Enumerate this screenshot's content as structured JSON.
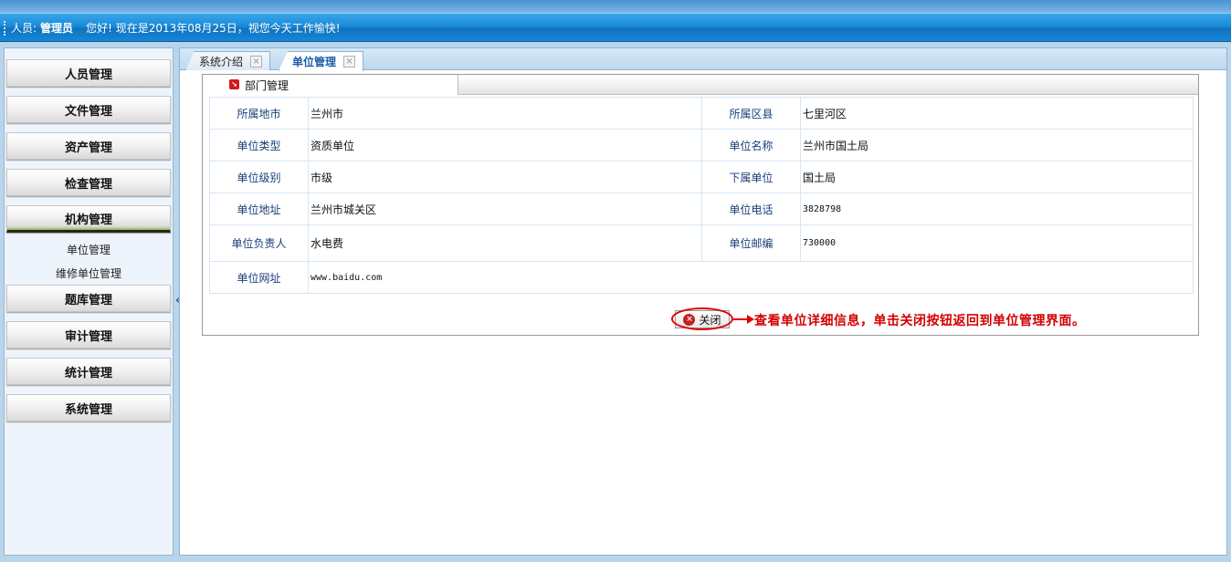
{
  "header": {
    "user_label": "人员:",
    "user_name": "管理员",
    "greeting": "您好! 现在是2013年08月25日，视您今天工作愉快!"
  },
  "sidebar": {
    "menus": [
      {
        "label": "人员管理"
      },
      {
        "label": "文件管理"
      },
      {
        "label": "资产管理"
      },
      {
        "label": "检查管理"
      },
      {
        "label": "机构管理"
      },
      {
        "label": "题库管理"
      },
      {
        "label": "审计管理"
      },
      {
        "label": "统计管理"
      },
      {
        "label": "系统管理"
      }
    ],
    "sub_items": [
      {
        "label": "单位管理"
      },
      {
        "label": "维修单位管理"
      }
    ],
    "collapse_glyph": "«"
  },
  "tabs": [
    {
      "label": "系统介绍",
      "close": "×"
    },
    {
      "label": "单位管理",
      "close": "×"
    }
  ],
  "panel": {
    "title": "部门管理",
    "icon_glyph": "↘"
  },
  "details": {
    "city_label": "所属地市",
    "city": "兰州市",
    "county_label": "所属区县",
    "county": "七里河区",
    "type_label": "单位类型",
    "type": "资质单位",
    "name_label": "单位名称",
    "name": "兰州市国土局",
    "level_label": "单位级别",
    "level": "市级",
    "sub_label": "下属单位",
    "sub": "国土局",
    "address_label": "单位地址",
    "address": "兰州市城关区",
    "phone_label": "单位电话",
    "phone": "3828798",
    "leader_label": "单位负责人",
    "leader": "水电费",
    "zip_label": "单位邮编",
    "zip": "730000",
    "website_label": "单位网址",
    "website": "www.baidu.com"
  },
  "close_button": {
    "label": "关闭",
    "icon_glyph": "×"
  },
  "annotation": "查看单位详细信息，单击关闭按钮返回到单位管理界面。"
}
